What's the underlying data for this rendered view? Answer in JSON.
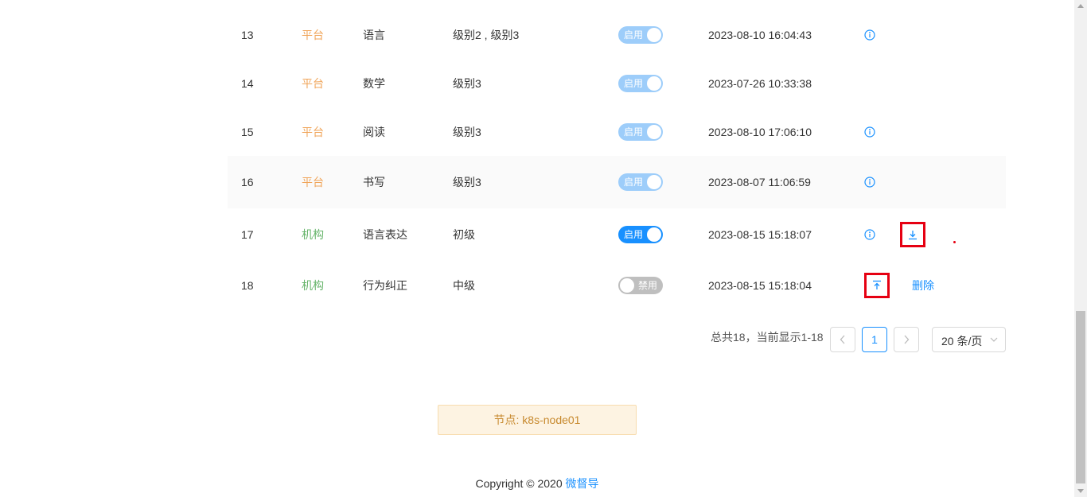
{
  "table": {
    "rows": [
      {
        "id": "13",
        "source": "平台",
        "name": "语言",
        "level": "级别2 , 级别3",
        "status": "启用",
        "time": "2023-08-10 16:04:43"
      },
      {
        "id": "14",
        "source": "平台",
        "name": "数学",
        "level": "级别3",
        "status": "启用",
        "time": "2023-07-26 10:33:38"
      },
      {
        "id": "15",
        "source": "平台",
        "name": "阅读",
        "level": "级别3",
        "status": "启用",
        "time": "2023-08-10 17:06:10"
      },
      {
        "id": "16",
        "source": "平台",
        "name": "书写",
        "level": "级别3",
        "status": "启用",
        "time": "2023-08-07 11:06:59"
      },
      {
        "id": "17",
        "source": "机构",
        "name": "语言表达",
        "level": "初级",
        "status": "启用",
        "time": "2023-08-15 15:18:07"
      },
      {
        "id": "18",
        "source": "机构",
        "name": "行为纠正",
        "level": "中级",
        "status": "禁用",
        "time": "2023-08-15 15:18:04",
        "delete_label": "删除"
      }
    ]
  },
  "pagination": {
    "summary": "总共18，当前显示1-18",
    "current_page": "1",
    "page_size": "20 条/页"
  },
  "node": {
    "label": "节点: k8s-node01"
  },
  "footer": {
    "copyright": "Copyright © 2020 ",
    "brand": "微督导"
  },
  "colors": {
    "accent": "#1890ff",
    "platform": "#f0a55a",
    "org": "#66b46a",
    "highlight": "#e60012"
  }
}
